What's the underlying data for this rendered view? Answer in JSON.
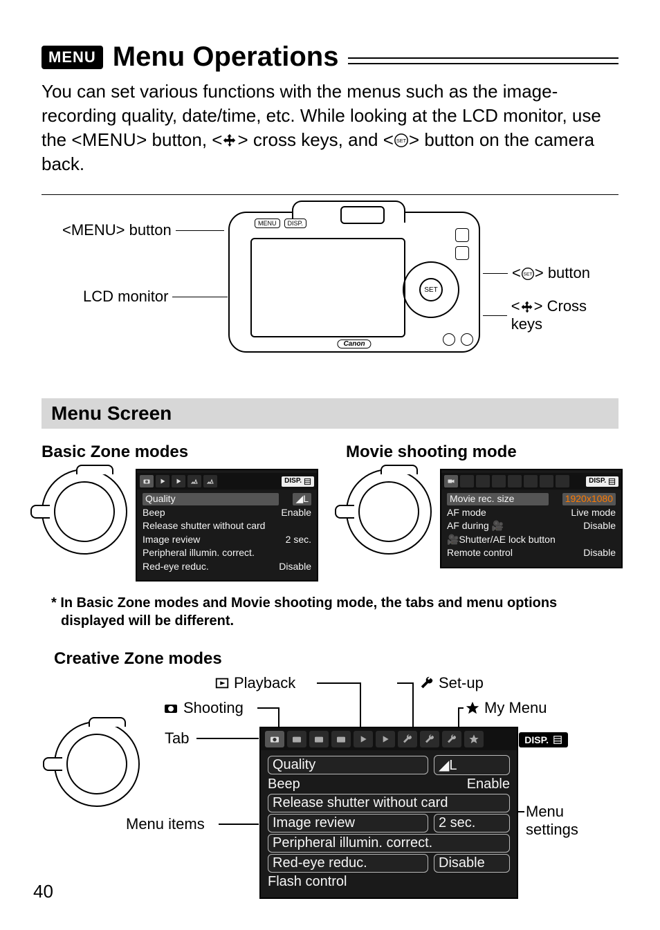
{
  "page_number": "40",
  "heading_badge": "MENU",
  "heading_title": "Menu Operations",
  "intro_html_parts": {
    "p1": "You can set various functions with the menus such as the image-recording quality, date/time, etc. While looking at the LCD monitor, use the <",
    "menu_word": "MENU",
    "p2": "> button, <",
    "p3": "> cross keys, and <",
    "set_word": "SET",
    "p4": "> button on the camera back."
  },
  "figure1": {
    "menu_button_label": "> button",
    "menu_prefix": "<MENU",
    "lcd_label": "LCD monitor",
    "set_button_label": "> button",
    "set_prefix": "<",
    "cross_keys_label": "> Cross keys",
    "cross_prefix": "<",
    "brand": "Canon",
    "mini_menu": "MENU",
    "mini_disp": "DISP.",
    "set_center": "SET"
  },
  "menu_screen_heading": "Menu Screen",
  "basic": {
    "title": "Basic Zone modes",
    "disp": "DISP.",
    "rows": [
      {
        "k": "Quality",
        "v": "◢L",
        "hl": true
      },
      {
        "k": "Beep",
        "v": "Enable"
      },
      {
        "k": "Release shutter without card",
        "v": ""
      },
      {
        "k": "Image review",
        "v": "2 sec."
      },
      {
        "k": "Peripheral illumin. correct.",
        "v": ""
      },
      {
        "k": "Red-eye reduc.",
        "v": "Disable"
      }
    ]
  },
  "movie": {
    "title": "Movie shooting mode",
    "disp": "DISP.",
    "rows": [
      {
        "k": "Movie rec. size",
        "v": "1920x1080",
        "hl": true,
        "orange": true
      },
      {
        "k": "AF mode",
        "v": "Live mode"
      },
      {
        "k": "AF during 🎥",
        "v": "Disable"
      },
      {
        "k": "🎥Shutter/AE lock button",
        "v": ""
      },
      {
        "k": "Remote control",
        "v": "Disable"
      }
    ]
  },
  "footnote": "* In Basic Zone modes and Movie shooting mode, the tabs and menu options displayed will be different.",
  "creative": {
    "title": "Creative Zone modes",
    "labels": {
      "playback": "Playback",
      "setup": "Set-up",
      "shooting": "Shooting",
      "mymenu": "My Menu",
      "tab": "Tab",
      "menu_items": "Menu items",
      "menu_settings": "Menu settings"
    },
    "disp": "DISP.",
    "rows": [
      {
        "k": "Quality",
        "v": "◢L",
        "boxed": true
      },
      {
        "k": "Beep",
        "v": "Enable"
      },
      {
        "k": "Release shutter without card",
        "v": "",
        "boxed": true
      },
      {
        "k": "Image review",
        "v": "2 sec.",
        "boxed": true
      },
      {
        "k": "Peripheral illumin. correct.",
        "v": "",
        "boxed": true
      },
      {
        "k": "Red-eye reduc.",
        "v": "Disable",
        "boxed": true
      },
      {
        "k": "Flash control",
        "v": ""
      }
    ]
  }
}
